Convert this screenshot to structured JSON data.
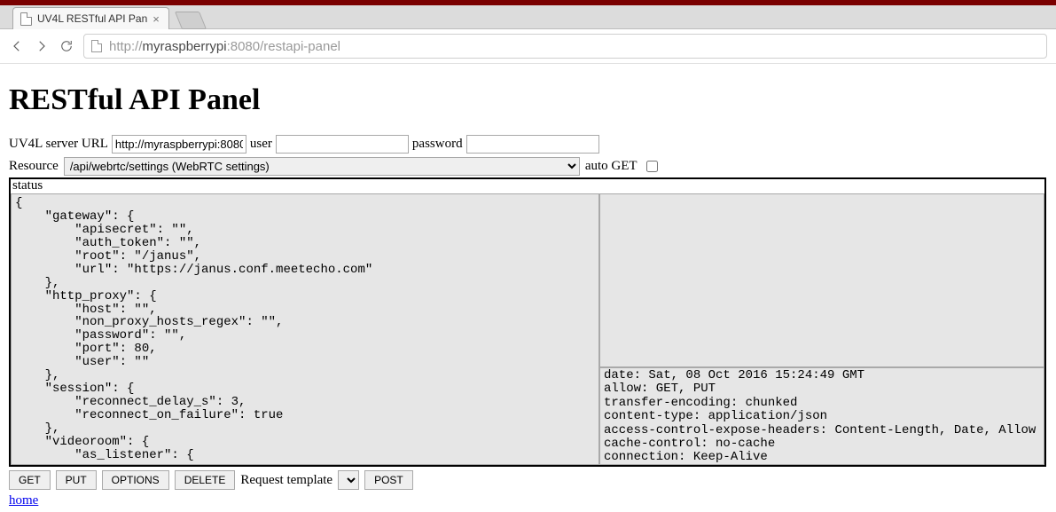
{
  "browser": {
    "tab_title": "UV4L RESTful API Pan",
    "url_prefix": "http://",
    "url_host": "myraspberrypi",
    "url_port": ":8080",
    "url_path": "/restapi-panel"
  },
  "page": {
    "heading": "RESTful API Panel",
    "form": {
      "server_url_label": "UV4L server URL",
      "server_url_value": "http://myraspberrypi:8080",
      "user_label": "user",
      "user_value": "",
      "password_label": "password",
      "password_value": "",
      "resource_label": "Resource",
      "resource_selected": "/api/webrtc/settings (WebRTC settings)",
      "autoget_label": "auto GET",
      "autoget_checked": false
    },
    "panels": {
      "status_label": "status",
      "json_body": "{\n    \"gateway\": {\n        \"apisecret\": \"\",\n        \"auth_token\": \"\",\n        \"root\": \"/janus\",\n        \"url\": \"https://janus.conf.meetecho.com\"\n    },\n    \"http_proxy\": {\n        \"host\": \"\",\n        \"non_proxy_hosts_regex\": \"\",\n        \"password\": \"\",\n        \"port\": 80,\n        \"user\": \"\"\n    },\n    \"session\": {\n        \"reconnect_delay_s\": 3,\n        \"reconnect_on_failure\": true\n    },\n    \"videoroom\": {\n        \"as_listener\": {",
      "headers": "date: Sat, 08 Oct 2016 15:24:49 GMT\nallow: GET, PUT\ntransfer-encoding: chunked\ncontent-type: application/json\naccess-control-expose-headers: Content-Length, Date, Allow\ncache-control: no-cache\nconnection: Keep-Alive"
    },
    "buttons": {
      "get": "GET",
      "put": "PUT",
      "options": "OPTIONS",
      "delete": "DELETE",
      "template_label": "Request template",
      "post": "POST"
    },
    "home_link": "home"
  }
}
